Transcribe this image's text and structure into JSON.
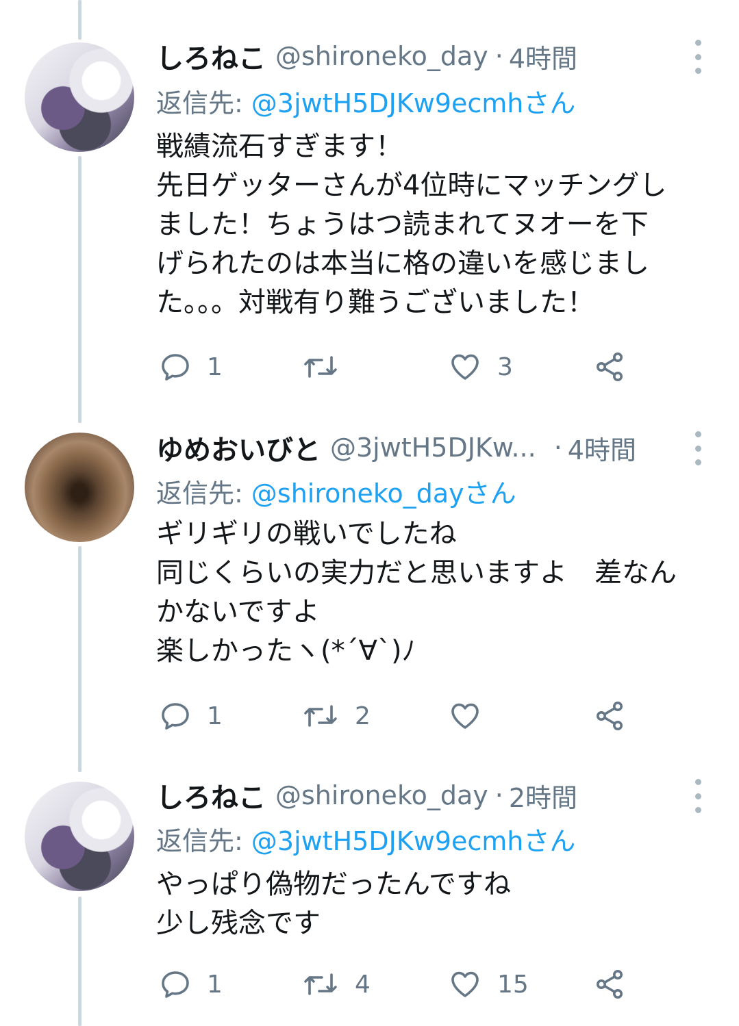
{
  "tweets": [
    {
      "name": "しろねこ",
      "handle": "@shironeko_day",
      "separator": "·",
      "time": "4時間",
      "reply_prefix": "返信先: ",
      "reply_mention": "@3jwtH5DJKw9ecmhさん",
      "body": "戦績流石すぎます！\n先日ゲッターさんが4位時にマッチングし\nました！ちょうはつ読まれてヌオーを下\nげられたのは本当に格の違いを感じまし\nた。。。対戦有り難うございました！",
      "counts": {
        "reply": "1",
        "retweet": "",
        "like": "3"
      },
      "avatar_icon": "avatar-anime-girl-pokemon"
    },
    {
      "name": "ゆめおいびと",
      "handle": "@3jwtH5DJKw...",
      "separator": "·",
      "time": "4時間",
      "reply_prefix": "返信先: ",
      "reply_mention": "@shironeko_dayさん",
      "body": "ギリギリの戦いでしたね\n同じくらいの実力だと思いますよ　差なん\nかないですよ\n楽しかったヽ(*´∀`)ﾉ",
      "counts": {
        "reply": "1",
        "retweet": "2",
        "like": ""
      },
      "avatar_icon": "avatar-brown-photo"
    },
    {
      "name": "しろねこ",
      "handle": "@shironeko_day",
      "separator": "·",
      "time": "2時間",
      "reply_prefix": "返信先: ",
      "reply_mention": "@3jwtH5DJKw9ecmhさん",
      "body": "やっぱり偽物だったんですね\n少し残念です",
      "counts": {
        "reply": "1",
        "retweet": "4",
        "like": "15"
      },
      "avatar_icon": "avatar-anime-girl-pokemon"
    }
  ],
  "colors": {
    "accent": "#1da1f2",
    "secondary_text": "#657786",
    "thread_line": "#ccd6dd"
  }
}
